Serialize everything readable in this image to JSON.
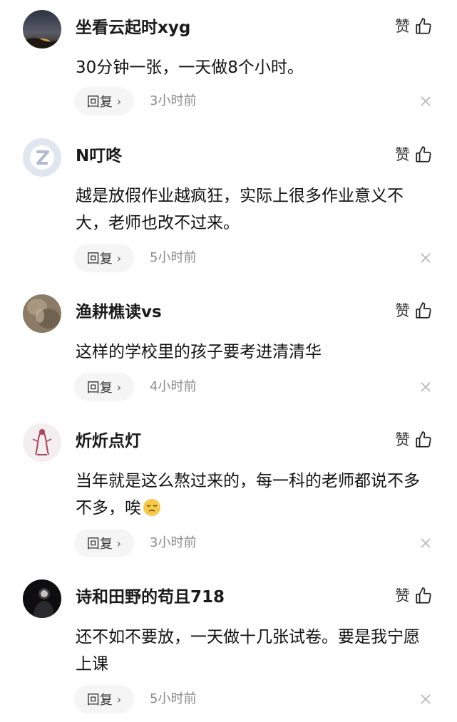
{
  "comments": [
    {
      "username": "坐看云起时xyg",
      "avatar_icon": "sunset-avatar",
      "text": "30分钟一张，一天做8个小时。",
      "emoji": "",
      "like_label": "赞",
      "reply_label": "回复",
      "time": "3小时前"
    },
    {
      "username": "N叮咚",
      "avatar_icon": "z-logo-avatar",
      "text": "越是放假作业越疯狂，实际上很多作业意义不大，老师也改不过来。",
      "emoji": "",
      "like_label": "赞",
      "reply_label": "回复",
      "time": "5小时前"
    },
    {
      "username": "渔耕樵读vs",
      "avatar_icon": "stone-avatar",
      "text": "这样的学校里的孩子要考进清清华",
      "emoji": "",
      "like_label": "赞",
      "reply_label": "回复",
      "time": "4小时前"
    },
    {
      "username": "炘炘点灯",
      "avatar_icon": "zodiac-avatar",
      "text": "当年就是这么熬过来的，每一科的老师都说不多不多，唉",
      "emoji": "pensive-face",
      "like_label": "赞",
      "reply_label": "回复",
      "time": "3小时前"
    },
    {
      "username": "诗和田野的苟且718",
      "avatar_icon": "person-dark-avatar",
      "text": "还不如不要放，一天做十几张试卷。要是我宁愿上课",
      "emoji": "",
      "like_label": "赞",
      "reply_label": "回复",
      "time": "5小时前"
    }
  ],
  "colors": {
    "background": "#ffffff",
    "username": "#1a1a1a",
    "text": "#111111",
    "meta": "#8a8a8a",
    "reply_bg": "#f5f5f5"
  }
}
